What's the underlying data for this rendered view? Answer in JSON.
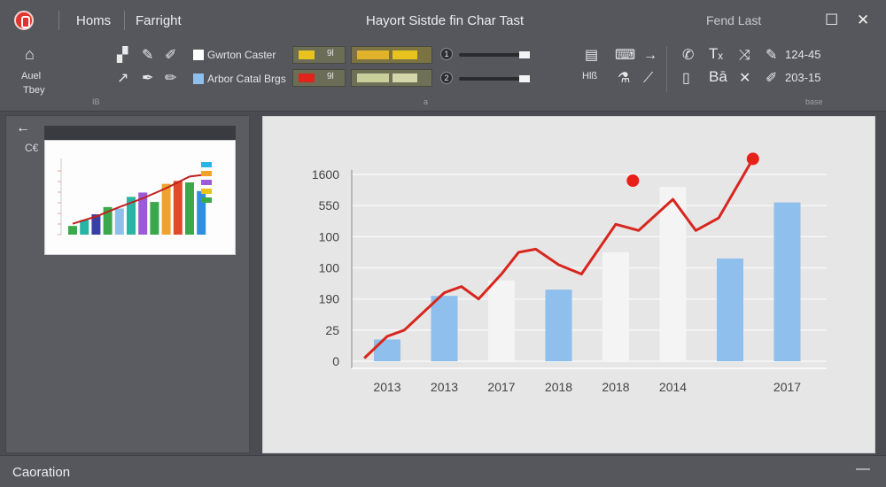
{
  "titlebar": {
    "menu_home": "Homs",
    "menu_second": "Farright",
    "doc_title": "Hayort Sistde fin Char Tast",
    "right_action": "Fend Last",
    "maximize_glyph": "☐",
    "close_glyph": "✕"
  },
  "ribbon": {
    "left_label_1": "Auel",
    "left_label_2": "Tbey",
    "series_1_label": "Gwrton Caster",
    "series_2_label": "Arbor Catal Brgs",
    "series_1_code": "9l",
    "series_2_code": "9l",
    "slider_1_index": "1",
    "slider_2_index": "2",
    "tool_label": "Hlß",
    "text_tool": "Tₓ",
    "bold_tool": "Bā",
    "size_1": "124-45",
    "size_2": "203-15",
    "group_mark_1": "IB",
    "group_mark_2": "a",
    "group_mark_3": "base"
  },
  "left_pane": {
    "back_glyph": "←",
    "label": "C€"
  },
  "status": {
    "label": "Caoration",
    "minimize_glyph": "—"
  },
  "colors": {
    "accent_red": "#d7261e",
    "bar_blue": "#8fbfec",
    "bar_white": "#f4f4f4",
    "swatch_yellow": "#e8c31f",
    "swatch_red": "#e0231b"
  },
  "chart_data": {
    "type": "bar",
    "categories": [
      "2013",
      "2013",
      "2017",
      "2018",
      "2018",
      "2014",
      "",
      "2017"
    ],
    "y_tick_labels": [
      "1600",
      "550",
      "100",
      "100",
      "190",
      "25",
      "0"
    ],
    "ylim": [
      0,
      6
    ],
    "grid": true,
    "bars": [
      {
        "value": 0.7,
        "color": "#8fbfec"
      },
      {
        "value": 2.1,
        "color": "#8fbfec"
      },
      {
        "value": 2.6,
        "color": "#f4f4f4"
      },
      {
        "value": 2.3,
        "color": "#8fbfec"
      },
      {
        "value": 3.5,
        "color": "#f4f4f4"
      },
      {
        "value": 5.6,
        "color": "#f4f4f4"
      },
      {
        "value": 3.3,
        "color": "#8fbfec"
      },
      {
        "value": 5.1,
        "color": "#8fbfec"
      }
    ],
    "line": {
      "color": "#d7261e",
      "points": [
        [
          -0.4,
          0.1
        ],
        [
          0.0,
          0.8
        ],
        [
          0.3,
          1.0
        ],
        [
          1.0,
          2.2
        ],
        [
          1.3,
          2.4
        ],
        [
          1.6,
          2.0
        ],
        [
          2.0,
          2.8
        ],
        [
          2.3,
          3.5
        ],
        [
          2.6,
          3.6
        ],
        [
          3.0,
          3.1
        ],
        [
          3.4,
          2.8
        ],
        [
          4.0,
          4.4
        ],
        [
          4.4,
          4.2
        ],
        [
          5.0,
          5.2
        ],
        [
          5.4,
          4.2
        ],
        [
          5.8,
          4.6
        ],
        [
          6.4,
          6.5
        ]
      ],
      "markers": [
        [
          4.3,
          5.8
        ],
        [
          6.4,
          6.5
        ]
      ]
    }
  },
  "thumbnail_data": {
    "bars": [
      {
        "v": 0.12,
        "c": "#3aa84b"
      },
      {
        "v": 0.2,
        "c": "#29b4a4"
      },
      {
        "v": 0.28,
        "c": "#3a3fa6"
      },
      {
        "v": 0.38,
        "c": "#3aa84b"
      },
      {
        "v": 0.36,
        "c": "#8fbfec"
      },
      {
        "v": 0.52,
        "c": "#29b4a4"
      },
      {
        "v": 0.58,
        "c": "#9c5bd6"
      },
      {
        "v": 0.45,
        "c": "#3aa84b"
      },
      {
        "v": 0.7,
        "c": "#f0a22c"
      },
      {
        "v": 0.74,
        "c": "#e04a2a"
      },
      {
        "v": 0.72,
        "c": "#3aa84b"
      },
      {
        "v": 0.6,
        "c": "#2f8ee0"
      }
    ],
    "line": [
      [
        0,
        0.15
      ],
      [
        2,
        0.25
      ],
      [
        4,
        0.38
      ],
      [
        6,
        0.5
      ],
      [
        8,
        0.64
      ],
      [
        10,
        0.8
      ],
      [
        11,
        0.82
      ]
    ],
    "legend_colors": [
      "#29b4e6",
      "#f0a22c",
      "#9c5bd6",
      "#e8c31f",
      "#3aa84b"
    ]
  }
}
